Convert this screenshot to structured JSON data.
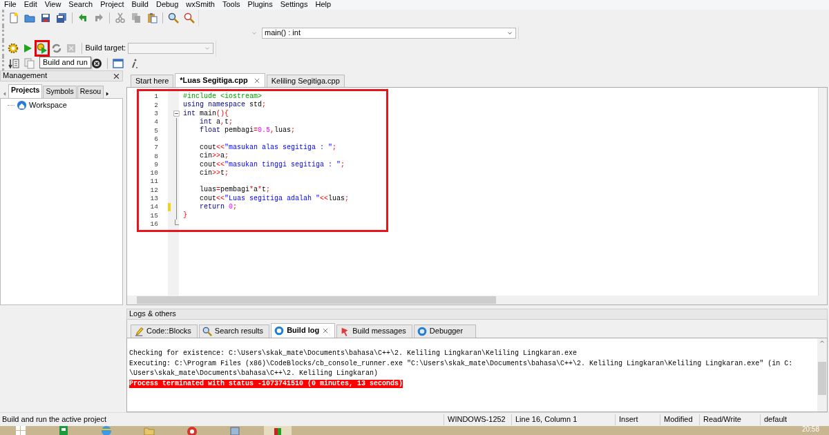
{
  "menu": [
    "File",
    "Edit",
    "View",
    "Search",
    "Project",
    "Build",
    "Debug",
    "wxSmith",
    "Tools",
    "Plugins",
    "Settings",
    "Help"
  ],
  "main_toolbar": [
    {
      "kind": "new",
      "disabled": false
    },
    {
      "kind": "open",
      "disabled": false
    },
    {
      "kind": "save",
      "disabled": false
    },
    {
      "kind": "saveall",
      "disabled": false
    },
    {
      "kind": "sep"
    },
    {
      "kind": "undo",
      "disabled": false
    },
    {
      "kind": "redo",
      "disabled": true
    },
    {
      "kind": "sep"
    },
    {
      "kind": "cut",
      "disabled": true
    },
    {
      "kind": "copy",
      "disabled": true
    },
    {
      "kind": "paste",
      "disabled": false
    },
    {
      "kind": "sep"
    },
    {
      "kind": "find",
      "disabled": false
    },
    {
      "kind": "replace",
      "disabled": false
    }
  ],
  "code_completion": {
    "function": "main() : int"
  },
  "compiler_toolbar": {
    "buttons": [
      {
        "kind": "build",
        "disabled": false,
        "highlighted": false
      },
      {
        "kind": "run",
        "disabled": false,
        "highlighted": false
      },
      {
        "kind": "buildrun",
        "disabled": false,
        "highlighted": true
      },
      {
        "kind": "rebuild",
        "disabled": false,
        "highlighted": false
      },
      {
        "kind": "abort",
        "disabled": true,
        "highlighted": false
      }
    ],
    "target_label": "Build target:"
  },
  "debug_toolbar": [
    {
      "kind": "jump"
    },
    {
      "kind": "doc"
    },
    {
      "kind": "stop"
    },
    {
      "kind": "sep"
    },
    {
      "kind": "window"
    },
    {
      "kind": "info"
    }
  ],
  "tooltip": "Build and run",
  "management": {
    "title": "Management",
    "tabs": [
      {
        "label": "Projects",
        "selected": true
      },
      {
        "label": "Symbols",
        "selected": false
      },
      {
        "label": "Resou",
        "selected": false
      }
    ],
    "tree": [
      {
        "label": "Workspace"
      }
    ]
  },
  "editor": {
    "tabs": [
      {
        "label": "Start here",
        "selected": false
      },
      {
        "label": "*Luas Segitiga.cpp",
        "selected": true
      },
      {
        "label": "Keliling Segitiga.cpp",
        "selected": false
      }
    ],
    "lines": [
      {
        "number": "1",
        "changed": false,
        "tokens": [
          {
            "text": "#include <iostream>",
            "kind": "preproc"
          }
        ]
      },
      {
        "number": "2",
        "changed": false,
        "tokens": [
          {
            "text": "using",
            "kind": "keyword"
          },
          {
            "text": " namespace",
            "kind": "keyword"
          },
          {
            "text": " std",
            "kind": "plain"
          },
          {
            "text": ";",
            "kind": "op"
          }
        ]
      },
      {
        "number": "3",
        "changed": false,
        "expanded": true,
        "tokens": [
          {
            "text": "int",
            "kind": "keyword"
          },
          {
            "text": " main",
            "kind": "plain"
          },
          {
            "text": "(){",
            "kind": "op"
          }
        ],
        "children": [
          {
            "number": "4",
            "changed": false,
            "tokens": [
              {
                "text": "    int",
                "kind": "keyword"
              },
              {
                "text": " a",
                "kind": "plain"
              },
              {
                "text": ",",
                "kind": "op"
              },
              {
                "text": "t",
                "kind": "plain"
              },
              {
                "text": ";",
                "kind": "op"
              }
            ]
          },
          {
            "number": "5",
            "changed": false,
            "tokens": [
              {
                "text": "    float",
                "kind": "keyword"
              },
              {
                "text": " pembagi",
                "kind": "plain"
              },
              {
                "text": "=",
                "kind": "op"
              },
              {
                "text": "0.5",
                "kind": "number"
              },
              {
                "text": ",",
                "kind": "op"
              },
              {
                "text": "luas",
                "kind": "plain"
              },
              {
                "text": ";",
                "kind": "op"
              }
            ]
          },
          {
            "number": "6",
            "changed": false
          },
          {
            "number": "7",
            "changed": false,
            "tokens": [
              {
                "text": "    cout",
                "kind": "plain"
              },
              {
                "text": "<<",
                "kind": "op"
              },
              {
                "text": "\"masukan alas segitiga : \"",
                "kind": "string"
              },
              {
                "text": ";",
                "kind": "op"
              }
            ]
          },
          {
            "number": "8",
            "changed": false,
            "tokens": [
              {
                "text": "    cin",
                "kind": "plain"
              },
              {
                "text": ">>",
                "kind": "op"
              },
              {
                "text": "a",
                "kind": "plain"
              },
              {
                "text": ";",
                "kind": "op"
              }
            ]
          },
          {
            "number": "9",
            "changed": false,
            "tokens": [
              {
                "text": "    cout",
                "kind": "plain"
              },
              {
                "text": "<<",
                "kind": "op"
              },
              {
                "text": "\"masukan tinggi segitiga : \"",
                "kind": "string"
              },
              {
                "text": ";",
                "kind": "op"
              }
            ]
          },
          {
            "number": "10",
            "changed": false,
            "tokens": [
              {
                "text": "    cin",
                "kind": "plain"
              },
              {
                "text": ">>",
                "kind": "op"
              },
              {
                "text": "t",
                "kind": "plain"
              },
              {
                "text": ";",
                "kind": "op"
              }
            ]
          },
          {
            "number": "11",
            "changed": false
          },
          {
            "number": "12",
            "changed": false,
            "tokens": [
              {
                "text": "    luas",
                "kind": "plain"
              },
              {
                "text": "=",
                "kind": "op"
              },
              {
                "text": "pembagi",
                "kind": "plain"
              },
              {
                "text": "*",
                "kind": "op"
              },
              {
                "text": "a",
                "kind": "plain"
              },
              {
                "text": "*",
                "kind": "op"
              },
              {
                "text": "t",
                "kind": "plain"
              },
              {
                "text": ";",
                "kind": "op"
              }
            ]
          },
          {
            "number": "13",
            "changed": false,
            "tokens": [
              {
                "text": "    cout",
                "kind": "plain"
              },
              {
                "text": "<<",
                "kind": "op"
              },
              {
                "text": "\"Luas segitiga adalah \"",
                "kind": "string"
              },
              {
                "text": "<<",
                "kind": "op"
              },
              {
                "text": "luas",
                "kind": "plain"
              },
              {
                "text": ";",
                "kind": "op"
              }
            ]
          },
          {
            "number": "14",
            "changed": true,
            "tokens": [
              {
                "text": "    return",
                "kind": "keyword"
              },
              {
                "text": " 0",
                "kind": "number"
              },
              {
                "text": ";",
                "kind": "op"
              }
            ]
          },
          {
            "number": "15",
            "changed": false,
            "tokens": [
              {
                "text": "}",
                "kind": "op"
              }
            ]
          },
          {
            "number": "16",
            "changed": false
          }
        ]
      }
    ]
  },
  "logs": {
    "title": "Logs & others",
    "tabs": [
      {
        "label": "Code::Blocks",
        "selected": false,
        "kind": "editor"
      },
      {
        "label": "Search results",
        "selected": false,
        "kind": "search"
      },
      {
        "label": "Build log",
        "selected": true,
        "kind": "build"
      },
      {
        "label": "Build messages",
        "selected": false,
        "kind": "messages"
      },
      {
        "label": "Debugger",
        "selected": false,
        "kind": "debugger"
      }
    ],
    "lines": [
      {
        "text": "Checking for existence: C:\\Users\\skak_mate\\Documents\\bahasa\\C++\\2. Keliling Lingkaran\\Keliling Lingkaran.exe",
        "kind": "info"
      },
      {
        "text": "Executing: C:\\Program Files (x86)\\CodeBlocks/cb_console_runner.exe \"C:\\Users\\skak_mate\\Documents\\bahasa\\C++\\2. Keliling Lingkaran\\Keliling Lingkaran.exe\" (in C:",
        "kind": "info"
      },
      {
        "text": "\\Users\\skak_mate\\Documents\\bahasa\\C++\\2. Keliling Lingkaran)",
        "kind": "info"
      },
      {
        "text": "Process terminated with status -1073741510 (0 minutes, 13 seconds)",
        "kind": "error"
      }
    ]
  },
  "status_bar": [
    "Build and run the active project",
    "WINDOWS-1252",
    "Line 16, Column 1",
    "Insert",
    "Modified",
    "Read/Write",
    "default"
  ],
  "taskbar": {
    "clock": "20:58"
  }
}
